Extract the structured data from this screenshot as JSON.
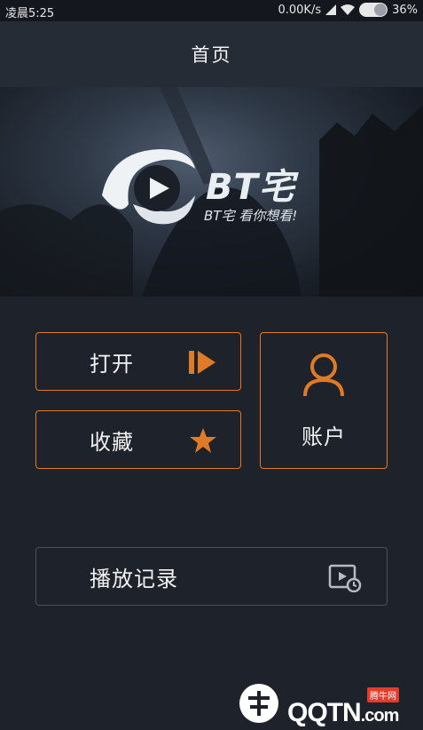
{
  "status_bar": {
    "time": "凌晨5:25",
    "network_speed": "0.00K/s",
    "battery": "36%"
  },
  "header": {
    "title": "首页"
  },
  "banner": {
    "brand": "BT宅",
    "slogan": "BT宅 看你想看!"
  },
  "menu": {
    "open_label": "打开",
    "favorites_label": "收藏",
    "account_label": "账户",
    "history_label": "播放记录"
  },
  "watermark": {
    "badge": "腾牛网",
    "text": "QQTN",
    "domain": ".com"
  },
  "colors": {
    "background": "#1e232b",
    "header": "#262c35",
    "accent": "#e07a26",
    "history_border": "#4a515c"
  },
  "icons": {
    "open": "play-icon",
    "favorites": "star-icon",
    "account": "user-icon",
    "history": "video-history-icon"
  }
}
